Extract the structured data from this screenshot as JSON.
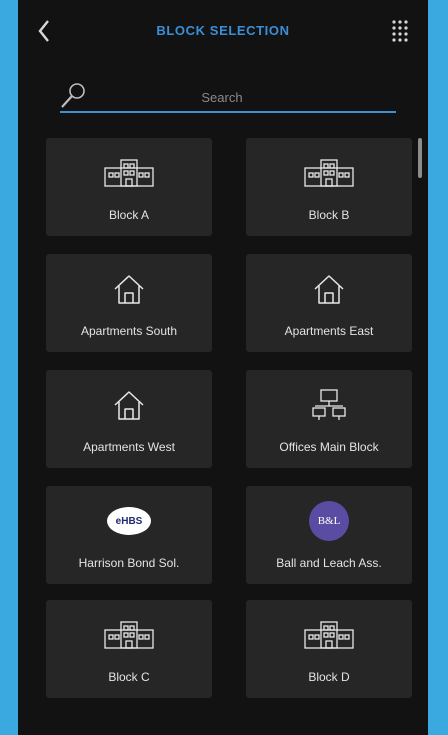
{
  "header": {
    "title": "BLOCK SELECTION"
  },
  "search": {
    "placeholder": "Search"
  },
  "tiles": [
    {
      "label": "Block A",
      "icon": "building-icon"
    },
    {
      "label": "Block B",
      "icon": "building-icon"
    },
    {
      "label": "Apartments South",
      "icon": "house-icon"
    },
    {
      "label": "Apartments East",
      "icon": "house-icon"
    },
    {
      "label": "Apartments West",
      "icon": "house-icon"
    },
    {
      "label": "Offices Main Block",
      "icon": "office-network-icon"
    },
    {
      "label": "Harrison Bond Sol.",
      "icon": "hbs-logo",
      "logo_text": "eHBS"
    },
    {
      "label": "Ball and Leach Ass.",
      "icon": "bl-logo",
      "logo_text": "B&L"
    },
    {
      "label": "Block C",
      "icon": "building-icon"
    },
    {
      "label": "Block D",
      "icon": "building-icon"
    }
  ],
  "colors": {
    "accent": "#3a8fd6",
    "background": "#121212",
    "tile": "#262626",
    "outer": "#39a9e0"
  }
}
